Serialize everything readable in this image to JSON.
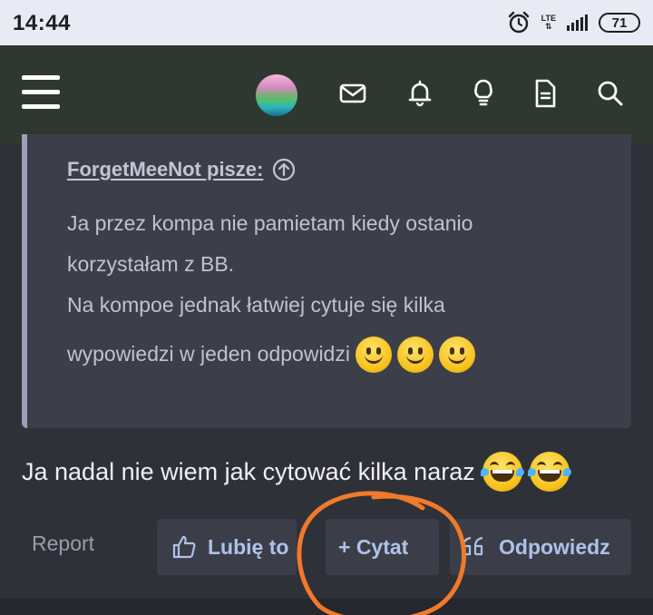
{
  "status_bar": {
    "time": "14:44",
    "network": "LTE",
    "battery": "71"
  },
  "nav": {
    "icons": [
      "menu-icon",
      "avatar",
      "mail-icon",
      "bell-icon",
      "lightbulb-icon",
      "document-icon",
      "search-icon"
    ]
  },
  "quote": {
    "author": "ForgetMeeNot pisze:",
    "lines": [
      "Ja przez kompa nie pamietam kiedy ostanio",
      "korzystałam z BB.",
      "Na kompoe jednak łatwiej cytuje się kilka",
      "wypowiedzi w jeden odpowidzi"
    ]
  },
  "post": {
    "text": "Ja nadal nie wiem jak cytować kilka naraz"
  },
  "actions": {
    "report": "Report",
    "like": "Lubię to",
    "quote": "+ Cytat",
    "reply": "Odpowiedz"
  },
  "colors": {
    "annotation": "#f07a2a",
    "accent": "#aec2e8"
  }
}
